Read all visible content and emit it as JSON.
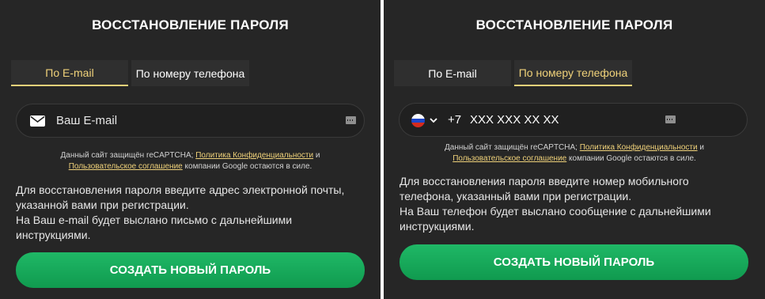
{
  "email_panel": {
    "title": "ВОССТАНОВЛЕНИЕ ПАРОЛЯ",
    "tab_email": "По E-mail",
    "tab_phone": "По номеру телефона",
    "active_tab": "email",
    "email_placeholder": "Ваш E-mail",
    "captcha_prefix": "Данный сайт защищён reCAPTCHA;",
    "privacy_link": "Политика Конфиденциальности",
    "captcha_and": "и",
    "terms_link": "Пользовательское соглашение",
    "captcha_suffix": "компании Google остаются в силе.",
    "info_line1": "Для восстановления пароля введите адрес электронной почты,",
    "info_line2": "указанной вами при регистрации.",
    "info_line3": "На Ваш e-mail будет выслано письмо с дальнейшими",
    "info_line4": "инструкциями.",
    "submit_label": "СОЗДАТЬ НОВЫЙ ПАРОЛЬ"
  },
  "phone_panel": {
    "title": "ВОССТАНОВЛЕНИЕ ПАРОЛЯ",
    "tab_email": "По E-mail",
    "tab_phone": "По номеру телефона",
    "active_tab": "phone",
    "country_code": "+7",
    "phone_placeholder": "XXX XXX XX XX",
    "captcha_prefix": "Данный сайт защищён reCAPTCHA;",
    "privacy_link": "Политика Конфиденциальности",
    "captcha_and": "и",
    "terms_link": "Пользовательское соглашение",
    "captcha_suffix": "компании Google остаются в силе.",
    "info_line1": "Для восстановления пароля введите номер мобильного",
    "info_line2": "телефона, указанный вами при регистрации.",
    "info_line3": "На Ваш телефон будет выслано сообщение с дальнейшими",
    "info_line4": "инструкциями.",
    "submit_label": "СОЗДАТЬ НОВЫЙ ПАРОЛЬ"
  },
  "colors": {
    "background": "#262626",
    "accent_gold": "#f0d27a",
    "button_green": "#13a456"
  },
  "icons": {
    "email_field": "envelope-icon",
    "password_manager": "password-manager-icon",
    "country_flag": "russia-flag-icon",
    "country_dropdown": "chevron-down-icon"
  }
}
